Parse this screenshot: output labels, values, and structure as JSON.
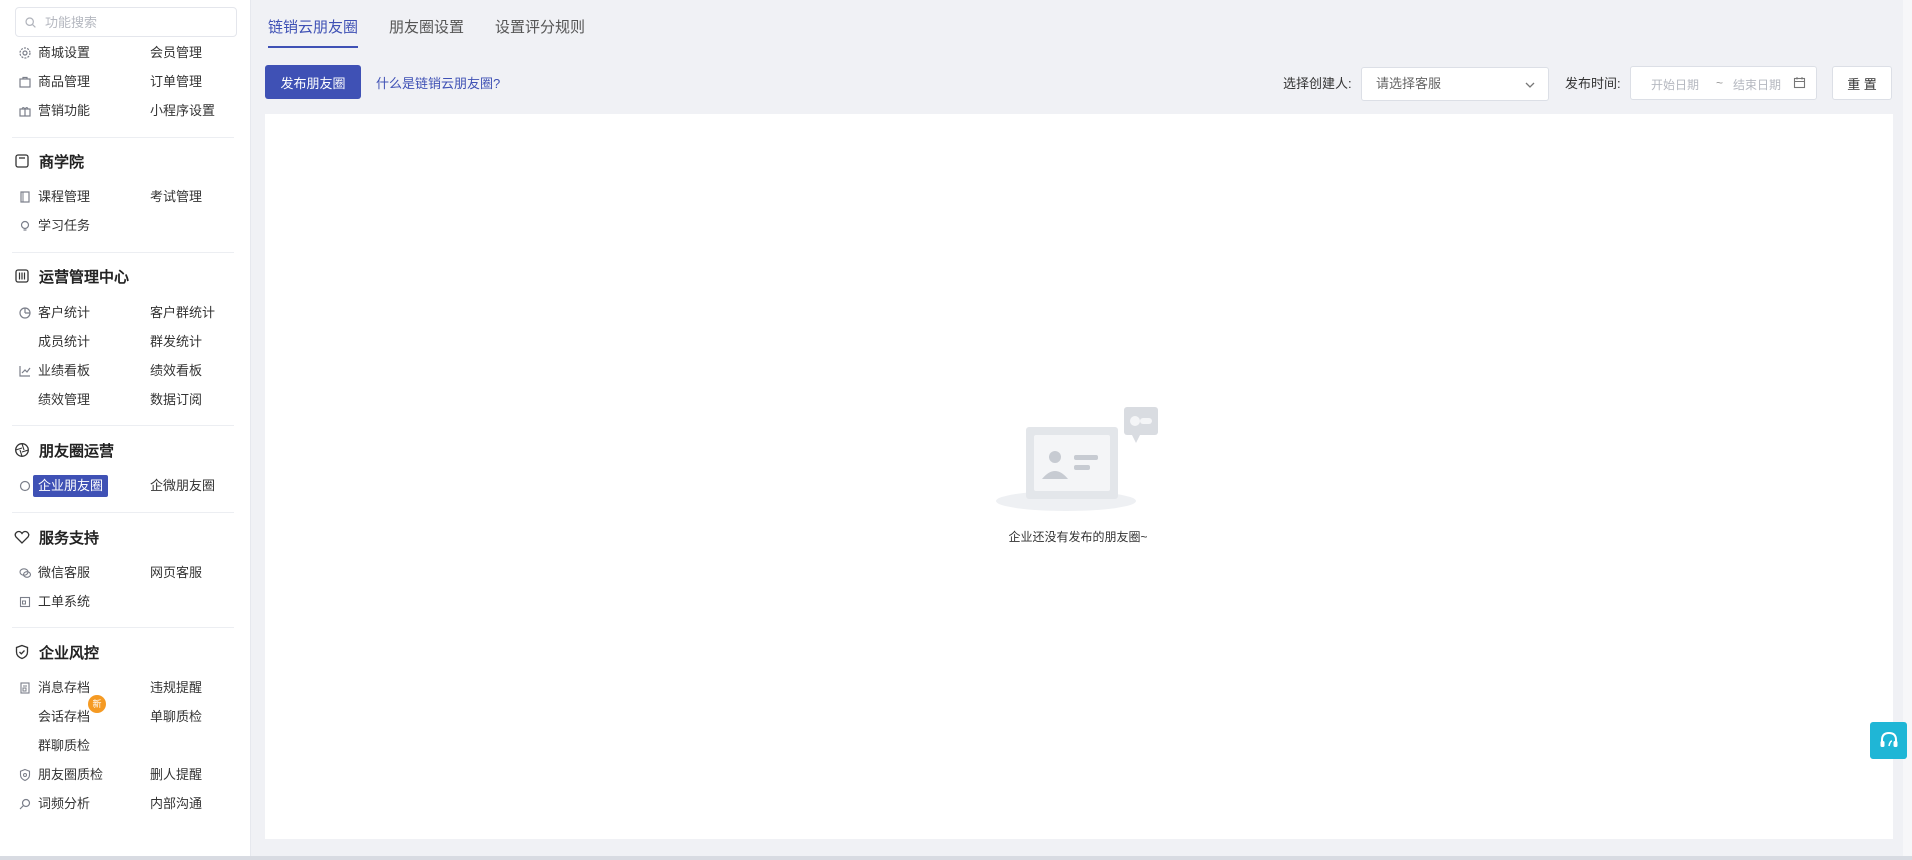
{
  "search": {
    "placeholder": "功能搜索"
  },
  "sidebar": {
    "group1": [
      {
        "label": "商城设置",
        "icon": "gear-icon"
      },
      {
        "label": "会员管理"
      },
      {
        "label": "商品管理",
        "icon": "bag-icon"
      },
      {
        "label": "订单管理"
      },
      {
        "label": "营销功能",
        "icon": "gift-icon"
      },
      {
        "label": "小程序设置"
      }
    ],
    "sections": [
      {
        "title": "商学院",
        "icon": "book-icon",
        "items": [
          "课程管理",
          "考试管理",
          "学习任务"
        ]
      },
      {
        "title": "运营管理中心",
        "icon": "sliders-icon",
        "items": [
          "客户统计",
          "客户群统计",
          "成员统计",
          "群发统计",
          "业绩看板",
          "绩效看板",
          "绩效管理",
          "数据订阅"
        ]
      },
      {
        "title": "朋友圈运营",
        "icon": "aperture-icon",
        "items": [
          "企业朋友圈",
          "企微朋友圈"
        ]
      },
      {
        "title": "服务支持",
        "icon": "heart-hand-icon",
        "items": [
          "微信客服",
          "网页客服",
          "工单系统"
        ]
      },
      {
        "title": "企业风控",
        "icon": "shield-check-icon",
        "items": [
          "消息存档",
          "违规提醒",
          "会话存档",
          "单聊质检",
          "群聊质检",
          "朋友圈质检",
          "删人提醒",
          "词频分析",
          "内部沟通"
        ]
      }
    ],
    "badge": "新"
  },
  "tabs": [
    "链销云朋友圈",
    "朋友圈设置",
    "设置评分规则"
  ],
  "toolbar": {
    "publish": "发布朋友圈",
    "help_link": "什么是链销云朋友圈?",
    "creator_label": "选择创建人:",
    "creator_placeholder": "请选择客服",
    "time_label": "发布时间:",
    "start_date": "开始日期",
    "separator": "~",
    "end_date": "结束日期",
    "reset": "重 置"
  },
  "empty": {
    "text": "企业还没有发布的朋友圈~"
  },
  "colors": {
    "primary": "#3f51b5",
    "support": "#1fb6d6",
    "badge": "#f59a23"
  }
}
